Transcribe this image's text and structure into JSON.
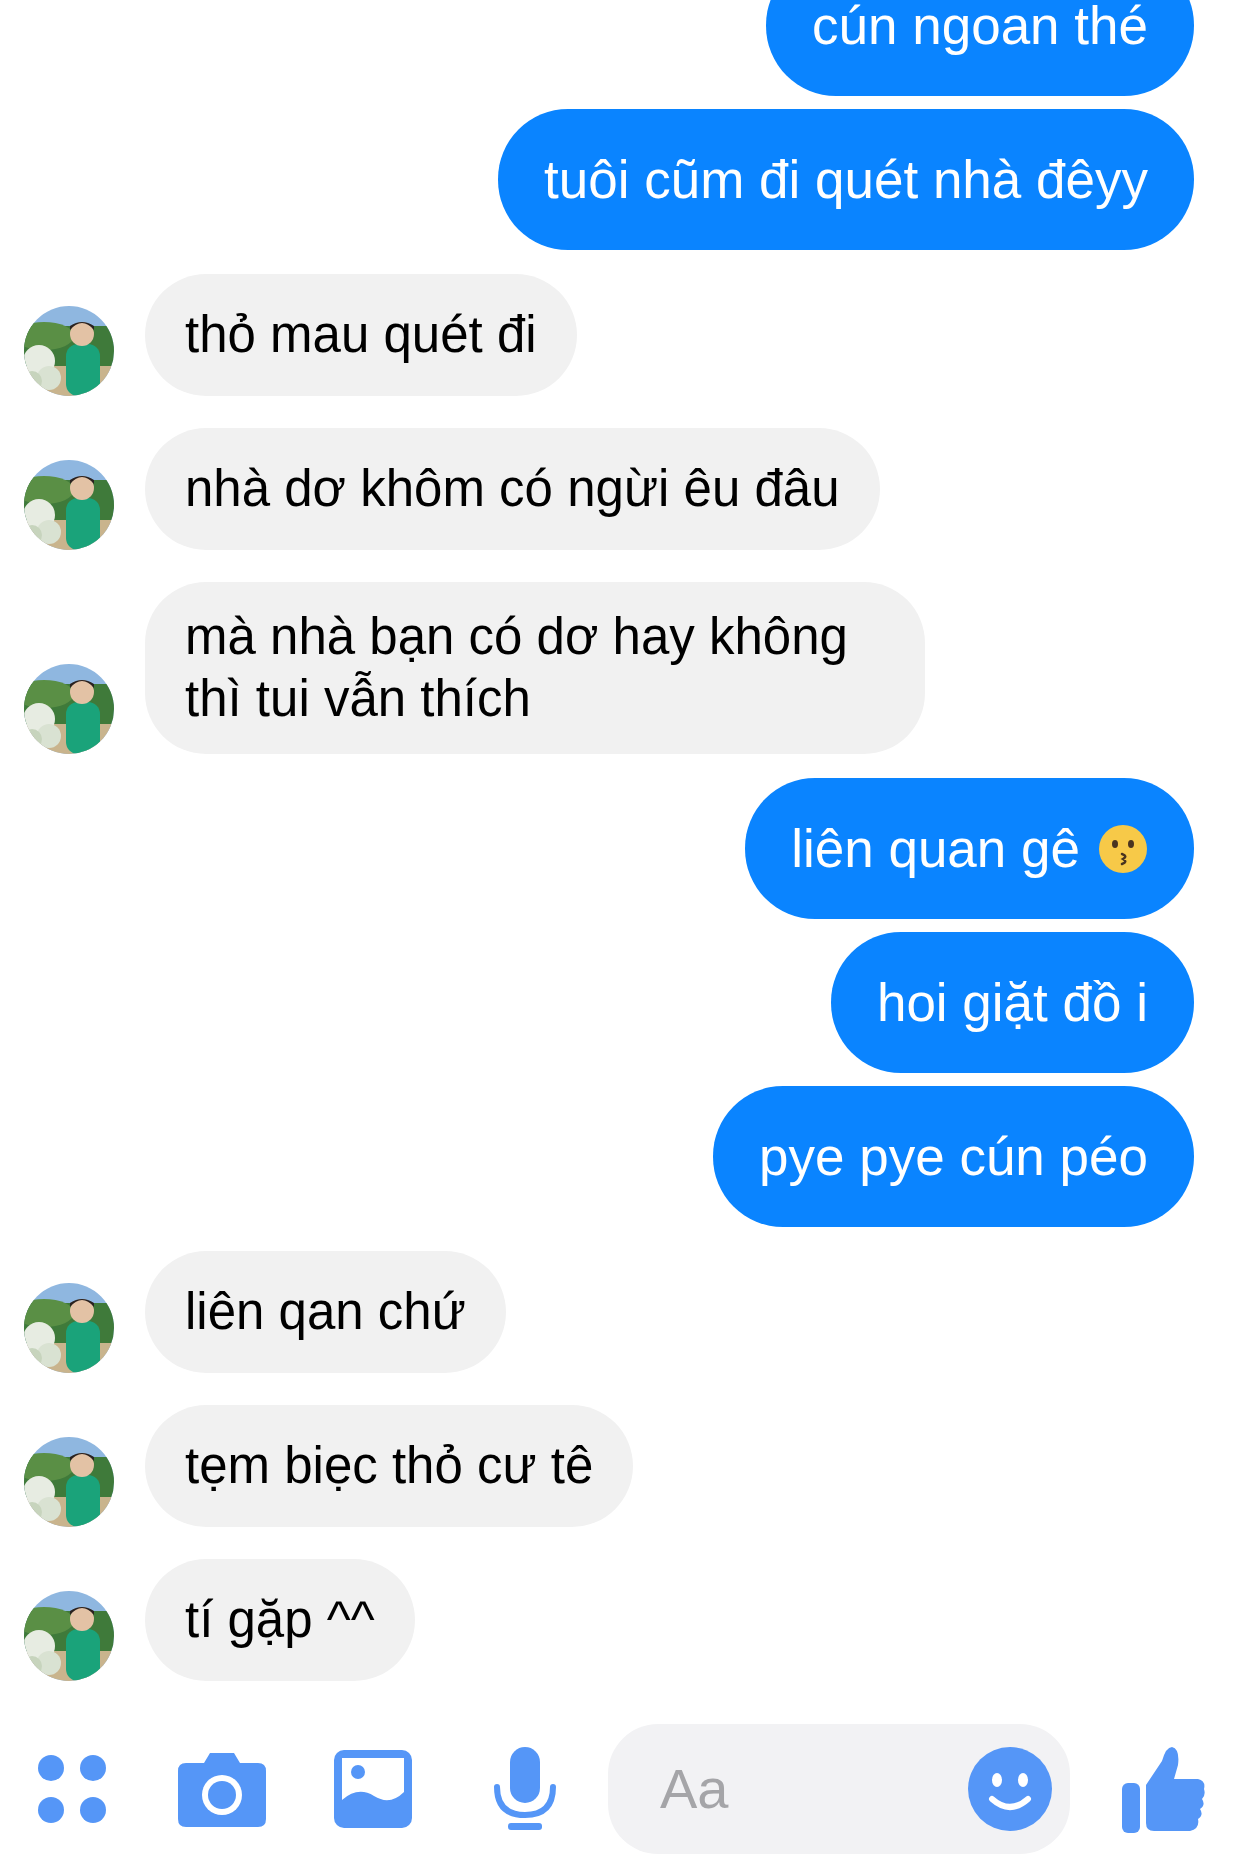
{
  "messages": [
    {
      "kind": "sent",
      "text": "cún ngoan thé"
    },
    {
      "kind": "sent",
      "text": "tuôi cũm đi quét nhà đêyy"
    },
    {
      "kind": "received",
      "text": "thỏ mau quét đi"
    },
    {
      "kind": "received",
      "text": "nhà dơ khôm có ngừi êu đâu"
    },
    {
      "kind": "received",
      "text": "mà nhà bạn có dơ hay không thì tui vẫn thích"
    },
    {
      "kind": "sent",
      "text": "liên quan gê",
      "emoji": true
    },
    {
      "kind": "sent",
      "text": "hoi giặt đồ i"
    },
    {
      "kind": "sent",
      "text": "pye pye cún péo"
    },
    {
      "kind": "received",
      "text": "liên qan chứ"
    },
    {
      "kind": "received",
      "text": "tẹm biẹc thỏ cư tê"
    },
    {
      "kind": "received",
      "text": "tí gặp ^^"
    }
  ],
  "composer": {
    "placeholder": "Aa"
  }
}
